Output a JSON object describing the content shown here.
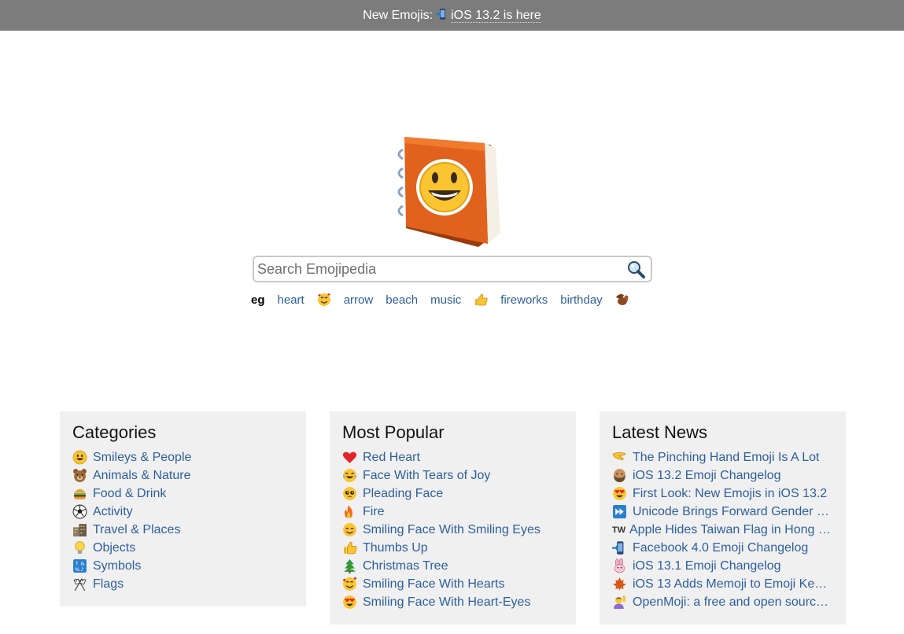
{
  "banner": {
    "prefix": "New Emojis:",
    "link_text": "iOS 13.2 is here",
    "icon": "mobile-phone-arrow-icon"
  },
  "logo": {
    "icon": "emojipedia-book-logo"
  },
  "search": {
    "placeholder": "Search Emojipedia",
    "icon": "magnifier-icon"
  },
  "suggestions": {
    "lead": "eg",
    "items": [
      {
        "type": "text",
        "label": "heart"
      },
      {
        "type": "emoji",
        "icon": "smiling-face-with-hearts-icon"
      },
      {
        "type": "text",
        "label": "arrow"
      },
      {
        "type": "text",
        "label": "beach"
      },
      {
        "type": "text",
        "label": "music"
      },
      {
        "type": "emoji",
        "icon": "thumbs-up-icon"
      },
      {
        "type": "text",
        "label": "fireworks"
      },
      {
        "type": "text",
        "label": "birthday"
      },
      {
        "type": "emoji",
        "icon": "turkey-icon"
      }
    ]
  },
  "categories": {
    "title": "Categories",
    "items": [
      {
        "label": "Smileys & People",
        "icon": "grinning-face-icon"
      },
      {
        "label": "Animals & Nature",
        "icon": "bear-face-icon"
      },
      {
        "label": "Food & Drink",
        "icon": "hamburger-icon"
      },
      {
        "label": "Activity",
        "icon": "soccer-ball-icon"
      },
      {
        "label": "Travel & Places",
        "icon": "buildings-icon"
      },
      {
        "label": "Objects",
        "icon": "light-bulb-icon"
      },
      {
        "label": "Symbols",
        "icon": "symbols-icon"
      },
      {
        "label": "Flags",
        "icon": "crossed-flags-icon"
      }
    ]
  },
  "popular": {
    "title": "Most Popular",
    "items": [
      {
        "label": "Red Heart",
        "icon": "red-heart-icon"
      },
      {
        "label": "Face With Tears of Joy",
        "icon": "tears-of-joy-icon"
      },
      {
        "label": "Pleading Face",
        "icon": "pleading-face-icon"
      },
      {
        "label": "Fire",
        "icon": "fire-icon"
      },
      {
        "label": "Smiling Face With Smiling Eyes",
        "icon": "smiling-eyes-icon"
      },
      {
        "label": "Thumbs Up",
        "icon": "thumbs-up-icon"
      },
      {
        "label": "Christmas Tree",
        "icon": "christmas-tree-icon"
      },
      {
        "label": "Smiling Face With Hearts",
        "icon": "smiling-face-with-hearts-icon"
      },
      {
        "label": "Smiling Face With Heart-Eyes",
        "icon": "heart-eyes-icon"
      }
    ]
  },
  "news": {
    "title": "Latest News",
    "items": [
      {
        "label": "The Pinching Hand Emoji Is A Lot",
        "icon": "pinching-hand-icon"
      },
      {
        "label": "iOS 13.2 Emoji Changelog",
        "icon": "bearded-face-icon"
      },
      {
        "label": "First Look: New Emojis in iOS 13.2",
        "icon": "heart-eyes-icon"
      },
      {
        "label": "Unicode Brings Forward Gender …",
        "icon": "fast-forward-icon"
      },
      {
        "label": "Apple Hides Taiwan Flag in Hong …",
        "icon": "tw-text-icon",
        "icon_text": "TW"
      },
      {
        "label": "Facebook 4.0 Emoji Changelog",
        "icon": "mobile-phone-arrow-icon"
      },
      {
        "label": "iOS 13.1 Emoji Changelog",
        "icon": "pink-rabbit-icon"
      },
      {
        "label": "iOS 13 Adds Memoji to Emoji Ke…",
        "icon": "maple-leaf-icon"
      },
      {
        "label": "OpenMoji: a free and open sourc…",
        "icon": "person-raising-hand-icon"
      }
    ]
  },
  "colors": {
    "banner_bg": "#7c7c7c",
    "link": "#2d5f9b",
    "panel_bg": "#f0f0f0",
    "book_orange": "#e0621c"
  }
}
